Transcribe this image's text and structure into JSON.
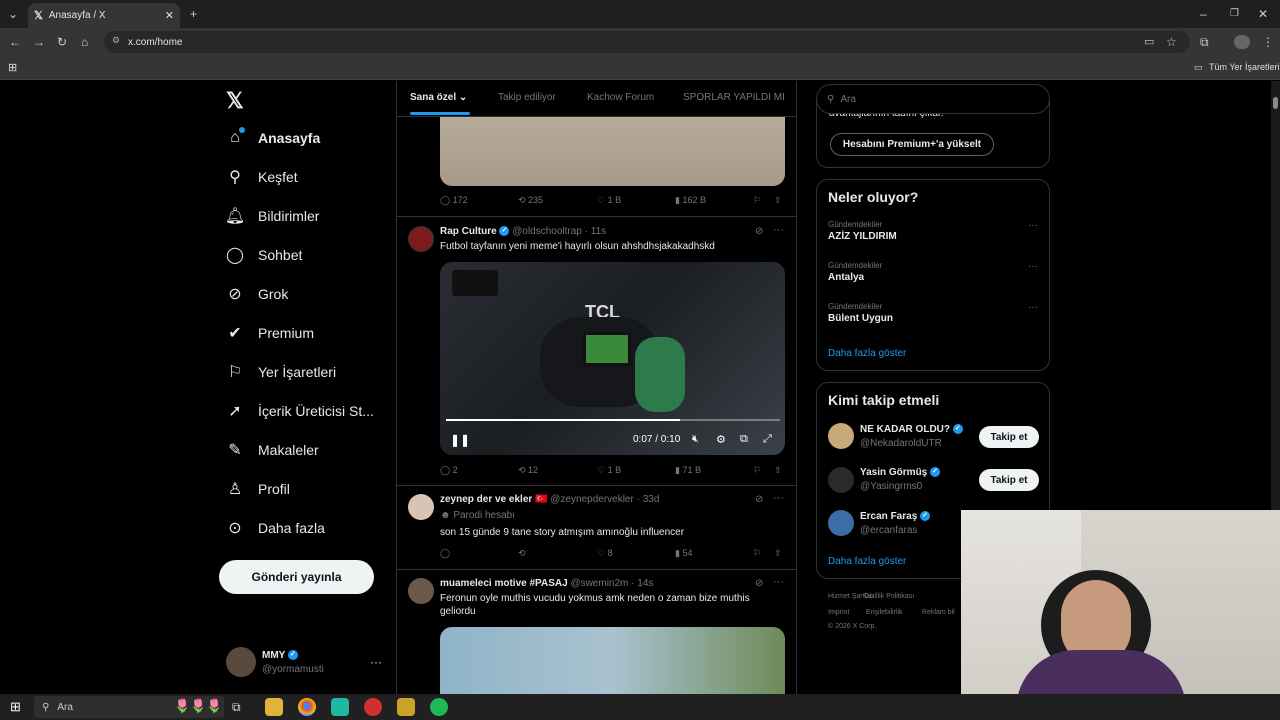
{
  "browser": {
    "tab_title": "Anasayfa / X",
    "tab_close": "✕",
    "new_tab": "+",
    "url": "x.com/home",
    "bookmarks_all": "Tüm Yer İşaretleri"
  },
  "nav": {
    "items": [
      {
        "label": "Anasayfa",
        "icon": "home-icon"
      },
      {
        "label": "Keşfet",
        "icon": "search-icon"
      },
      {
        "label": "Bildirimler",
        "icon": "bell-icon"
      },
      {
        "label": "Sohbet",
        "icon": "chat-icon"
      },
      {
        "label": "Grok",
        "icon": "grok-icon"
      },
      {
        "label": "Premium",
        "icon": "premium-icon"
      },
      {
        "label": "Yer İşaretleri",
        "icon": "bookmark-icon"
      },
      {
        "label": "İçerik Üreticisi St...",
        "icon": "rocket-icon"
      },
      {
        "label": "Makaleler",
        "icon": "article-icon"
      },
      {
        "label": "Profil",
        "icon": "person-icon"
      },
      {
        "label": "Daha fazla",
        "icon": "more-circle-icon"
      }
    ],
    "post_button": "Gönderi yayınla",
    "account": {
      "name": "MMY",
      "handle": "@yormamusti"
    }
  },
  "feed": {
    "tabs": [
      "Sana özel",
      "Takip ediliyor",
      "Kachow Forum",
      "SPORLAR YAPILDI MI"
    ],
    "post0_actions": {
      "replies": "172",
      "reposts": "235",
      "likes": "1 B",
      "views": "162 B"
    },
    "post1": {
      "name": "Rap Culture",
      "handle": "@oldschooltrap",
      "time": "· 11s",
      "text": "Futbol tayfanın yeni meme'i hayırlı olsun ahshdhsjakakadhskd",
      "video_time": "0:07 / 0:10",
      "video_progress": 0.7,
      "actions": {
        "replies": "2",
        "reposts": "12",
        "likes": "1 B",
        "views": "71 B"
      }
    },
    "post2": {
      "name": "zeynep der ve ekler 🇹🇷",
      "handle": "@zeynepdervekler",
      "time": "· 33d",
      "badge": "Parodi hesabı",
      "text": "son 15 günde 9 tane story atmışım amınoğlu influencer",
      "actions": {
        "replies": "",
        "reposts": "",
        "likes": "8",
        "views": "54"
      }
    },
    "post3": {
      "name": "muameleci motive #PASAJ",
      "handle": "@swemin2m",
      "time": "· 14s",
      "text": "Feronun oyle muthis vucudu yokmus amk neden o zaman bize muthis geliordu"
    }
  },
  "right": {
    "search_placeholder": "Ara",
    "premium_partial": "avantajlarının tadını çıkar.",
    "premium_button": "Hesabını Premium+'a yükselt",
    "trends_title": "Neler oluyor?",
    "trends": [
      {
        "context": "Gündemdekiler",
        "name": "AZİZ YILDIRIM"
      },
      {
        "context": "Gündemdekiler",
        "name": "Antalya"
      },
      {
        "context": "Gündemdekiler",
        "name": "Bülent Uygun"
      }
    ],
    "trends_more": "Daha fazla göster",
    "who_title": "Kimi takip etmeli",
    "who": [
      {
        "name": "NE KADAR OLDU?",
        "handle": "@NekadaroldUTR",
        "button": "Takip et"
      },
      {
        "name": "Yasin Görmüş",
        "handle": "@Yasingrms0",
        "button": "Takip et"
      },
      {
        "name": "Ercan Faraş",
        "handle": "@ercanfaras",
        "button": ""
      }
    ],
    "who_more": "Daha fazla göster",
    "footer": [
      "Hizmet Şartları",
      "Gizlilik Politikası",
      "Imprint",
      "Erişilebilirlik",
      "Reklam bil",
      "© 2026 X Corp."
    ]
  },
  "taskbar": {
    "search": "Ara"
  }
}
